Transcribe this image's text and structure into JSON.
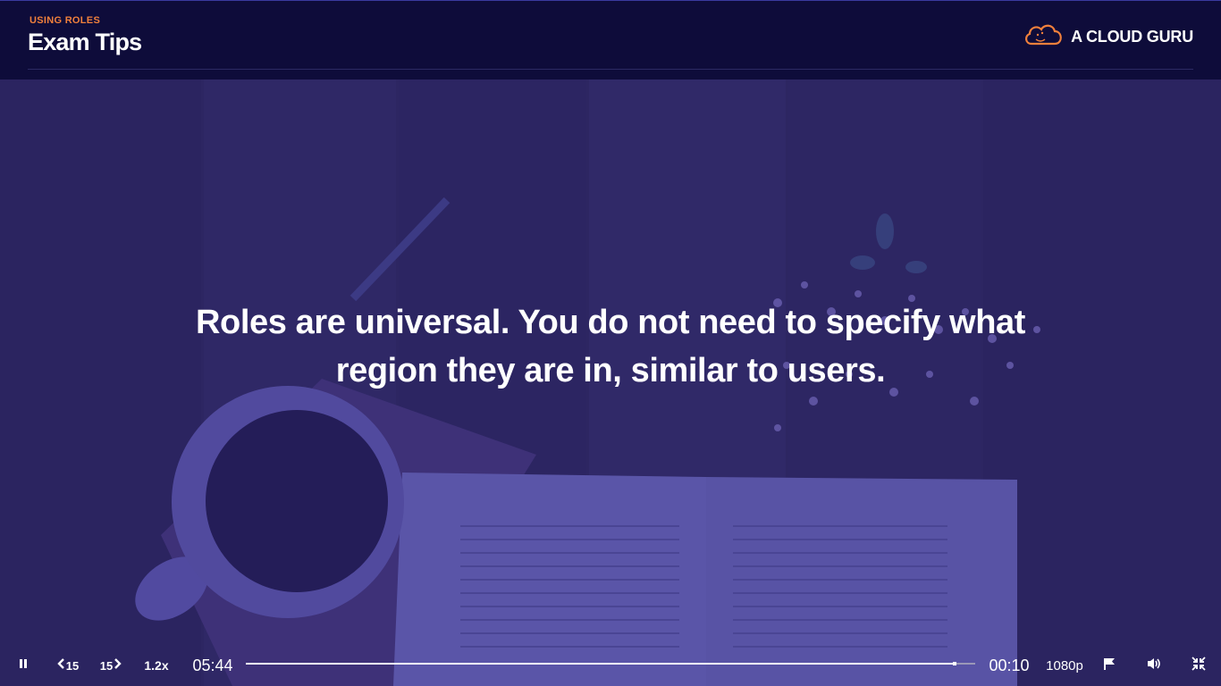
{
  "header": {
    "section": "USING ROLES",
    "title": "Exam Tips",
    "brand": "A CLOUD GURU",
    "brand_icon": "cloud-guru-logo-icon",
    "accent_color": "#f0803c"
  },
  "slide": {
    "tip_text": "Roles are universal. You do not need to specify what region they are in, similar to users."
  },
  "player": {
    "play_state_icon": "pause-icon",
    "rewind_label": "15",
    "forward_label": "15",
    "speed": "1.2x",
    "elapsed": "05:44",
    "remaining": "00:10",
    "progress_fraction": 0.972,
    "quality": "1080p",
    "icons": [
      "pause-icon",
      "rewind-15-icon",
      "forward-15-icon",
      "flag-icon",
      "volume-icon",
      "exit-fullscreen-icon"
    ]
  }
}
